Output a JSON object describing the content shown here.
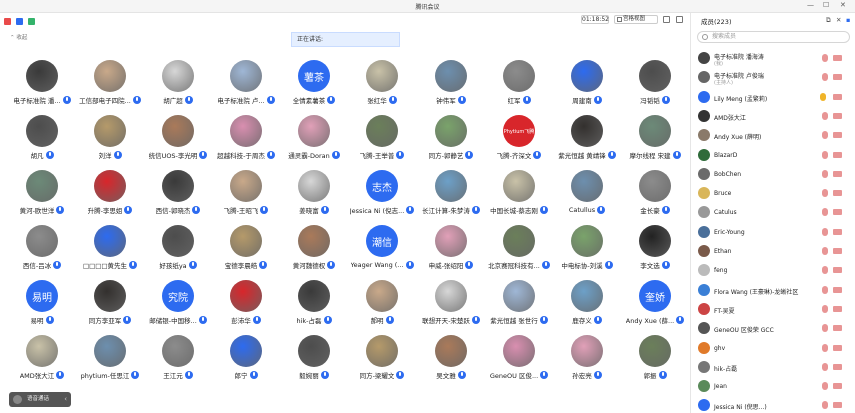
{
  "app": {
    "title": "腾讯会议"
  },
  "toolbar": {
    "timer": "01:18:52",
    "view_label": "宫格视图"
  },
  "main": {
    "speaking_label": "正在讲话:",
    "collapse_label": "收起"
  },
  "float_control": {
    "label": "语音通话"
  },
  "participants_panel": {
    "title": "成员(223)",
    "search_placeholder": "搜索成员",
    "items": [
      {
        "name": "电子标准院 潘海涛",
        "sub": "(我)",
        "mic": "muted"
      },
      {
        "name": "电子标准院 卢俊瑞",
        "sub": "(主持人)",
        "mic": "muted"
      },
      {
        "name": "Lily Meng (孟繁莉)",
        "sub": "",
        "mic": "hand"
      },
      {
        "name": "AMD张大江",
        "sub": "",
        "mic": "muted"
      },
      {
        "name": "Andy Xue (薛明)",
        "sub": "",
        "mic": "muted"
      },
      {
        "name": "BlazarD",
        "sub": "",
        "mic": "muted"
      },
      {
        "name": "BobChen",
        "sub": "",
        "mic": "muted"
      },
      {
        "name": "Bruce",
        "sub": "",
        "mic": "muted"
      },
      {
        "name": "Catulus",
        "sub": "",
        "mic": "muted"
      },
      {
        "name": "Eric-Young",
        "sub": "",
        "mic": "muted"
      },
      {
        "name": "Ethan",
        "sub": "",
        "mic": "muted"
      },
      {
        "name": "feng",
        "sub": "",
        "mic": "muted"
      },
      {
        "name": "Flora Wang (王豪琳)-龙蜥社区",
        "sub": "",
        "mic": "muted"
      },
      {
        "name": "FT-吴夏",
        "sub": "",
        "mic": "muted"
      },
      {
        "name": "GeneOU 区俊荣 GCC",
        "sub": "",
        "mic": "muted"
      },
      {
        "name": "ghv",
        "sub": "",
        "mic": "muted"
      },
      {
        "name": "hik-占磊",
        "sub": "",
        "mic": "muted"
      },
      {
        "name": "Jean",
        "sub": "",
        "mic": "muted"
      },
      {
        "name": "Jessica Ni (倪思...)",
        "sub": "",
        "mic": "muted"
      }
    ]
  },
  "grid": {
    "rows": [
      [
        "电子标准院 潘...",
        "工信部电子四院...",
        "胡广超",
        "电子标准院 卢...",
        "全情素薯茶",
        "张红华",
        "钟伟军",
        "红军",
        "周建南",
        "冯韬韬"
      ],
      [
        "胡凡",
        "刘洋",
        "统信UOS-李光明",
        "超越科技-于周杰",
        "通灵霸-Doran",
        "飞腾-王举普",
        "同方-郭静艺",
        "飞腾-齐深文",
        "紫光恒越 黄靖锋",
        "摩尔线程 宋建"
      ],
      [
        "黄河-欧世洋",
        "升腾-李思姐",
        "西信-郭晓杰",
        "飞腾-王昭飞",
        "姜晓富",
        "Jessica Ni (倪志...",
        "长江计算-朱梦涛",
        "中国长城-蔡志刚",
        "Catullus",
        "金长豪"
      ],
      [
        "西信-吕冰",
        "□□□□黄先生",
        "好孩纸ya",
        "宝德李晨皓",
        "黄河魏德权",
        "Yeager Wang (...",
        "申威-张绍阳",
        "北京赛冠科技有...",
        "中电标协-刘溪",
        "李文选"
      ],
      [
        "易明",
        "同方李亚军",
        "邮储银-中国移...",
        "彭沛华",
        "hik-占磊",
        "郝明",
        "联想开天-宋楚跃",
        "紫光恒越 张世行",
        "鹿存义",
        "Andy Xue (薛..."
      ],
      [
        "AMD张大江",
        "phytium-任思江",
        "王江元",
        "郎宁",
        "毅婉丽",
        "同方-梁耀文",
        "吴文雅",
        "GeneOU 区俊...",
        "孙宏亮",
        "郭振"
      ]
    ],
    "text_avatars": {
      "0-4": "薯茶",
      "2-5": "志杰",
      "3-5": "潮信",
      "4-0": "易明",
      "4-2": "究院",
      "4-9": "奎娇",
      "1-7": "Phytium飞腾"
    }
  }
}
